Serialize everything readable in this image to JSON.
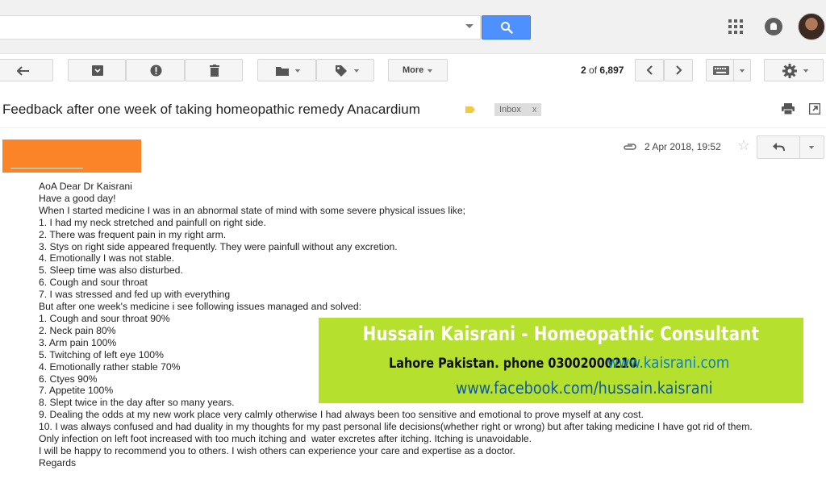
{
  "toolbar": {
    "more_label": "More",
    "pager_current": "2",
    "pager_of": "of",
    "pager_total": "6,897"
  },
  "email": {
    "subject": "Feedback after one week of taking homeopathic remedy Anacardium",
    "label": "Inbox",
    "label_close": "x",
    "date": "2 Apr 2018, 19:52",
    "body": "AoA Dear Dr Kaisrani\nHave a good day!\nWhen I started medicine I was in an abnormal state of mind with some severe physical issues like;\n1. I had my neck stretched and painfull on right side.\n2. There was frequent pain in my right arm.\n3. Stys on right side appeared frequently. They were painfull without any excretion.\n4. Emotionally I was not stable.\n5. Sleep time was also disturbed.\n6. Cough and sour throat\n7. I was stressed and fed up with everything\nBut after one week's medicine i see following issues managed and solved:\n1. Cough and sour throat 90%\n2. Neck pain 80%\n3. Arm pain 100%\n5. Twitching of left eye 100%\n4. Emotionally rather stable 70%\n6. Ctyes 90%\n7. Appetite 100%\n8. Slept twice in the day after so many years.\n9. Dealing the odds at my new work place very calmly otherwise I had always been too sensitive and emotional to prove myself at any cost.\n10. I was always confused and had duality in my thoughts for my past personal life decisions(whether right or wrong) but after taking medicine I have got rid of them.\nOnly infection on left foot increased with too much itching and  water excretes after itching. Itching is unavoidable.\nI will be happy to recommend you to others. I wish others can experience your care and expertise as a doctor.\nRegards"
  },
  "banner": {
    "title": "Hussain Kaisrani - Homeopathic Consultant",
    "line2": "Lahore Pakistan. phone 03002000210",
    "site": "www.kaisrani.com",
    "facebook": "www.facebook.com/hussain.kaisrani"
  },
  "colors": {
    "accent": "#4d90fe",
    "banner_bg": "#b6e02e",
    "redaction": "#fa8427"
  }
}
